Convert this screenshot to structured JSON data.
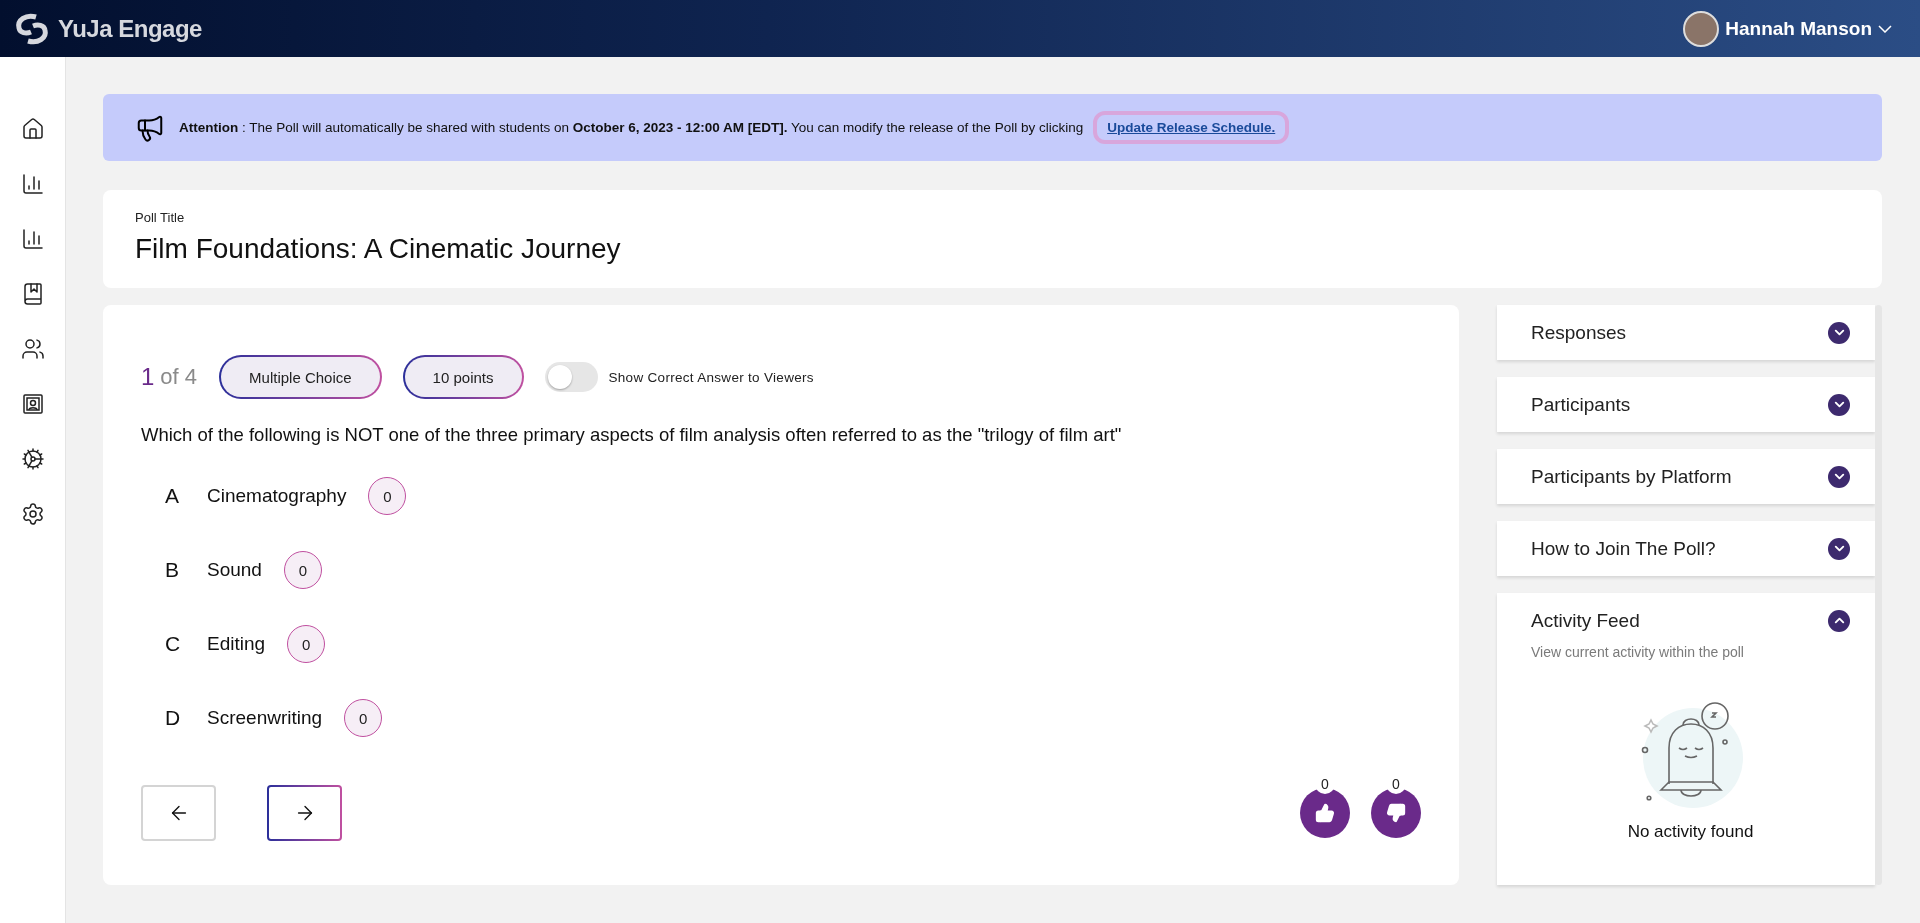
{
  "header": {
    "brand": "YuJa Engage",
    "user_name": "Hannah Manson"
  },
  "banner": {
    "message": "**Attention** : The Poll will automatically be shared with students on **October 6, 2023 - 12:00 AM [EDT].** You can modify the release of the Poll by clicking",
    "link": "Update Release Schedule."
  },
  "poll_title": {
    "label": "Poll Title",
    "value": "Film Foundations: A Cinematic Journey"
  },
  "question": {
    "number": "1",
    "of_total": "of 4",
    "type": "Multiple Choice",
    "points": "10 points",
    "toggle": {
      "label": "Show Correct Answer to Viewers",
      "on": false
    },
    "text": "Which of the following is NOT one of the three primary aspects of film analysis often referred to as the \"trilogy of film art\"",
    "options": [
      {
        "letter": "A",
        "text": "Cinematography",
        "count": "0"
      },
      {
        "letter": "B",
        "text": "Sound",
        "count": "0"
      },
      {
        "letter": "C",
        "text": "Editing",
        "count": "0"
      },
      {
        "letter": "D",
        "text": "Screenwriting",
        "count": "0"
      }
    ],
    "reactions": [
      {
        "kind": "like",
        "count": "0"
      },
      {
        "kind": "dislike",
        "count": "0"
      }
    ]
  },
  "panels": [
    {
      "title": "Responses",
      "expanded": false
    },
    {
      "title": "Participants",
      "expanded": false
    },
    {
      "title": "Participants by Platform",
      "expanded": false
    },
    {
      "title": "How to Join The Poll?",
      "expanded": false
    },
    {
      "title": "Activity Feed",
      "expanded": true,
      "subtitle": "View current activity within the poll",
      "empty_text": "No activity found"
    }
  ]
}
